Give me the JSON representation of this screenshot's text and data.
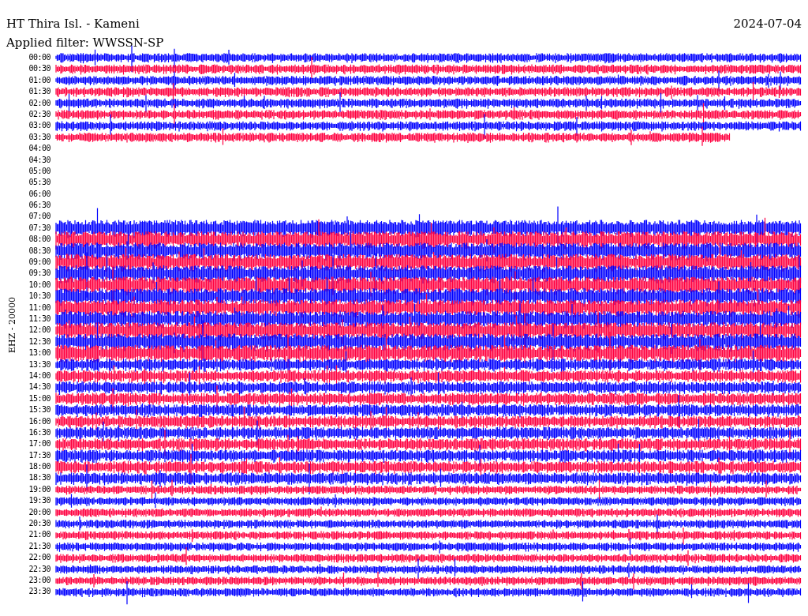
{
  "header": {
    "station": "HT Thira Isl. - Kameni",
    "date": "2024-07-04",
    "filter": "Applied filter: WWSSN-SP"
  },
  "channel_label": "EHZ - 20000",
  "rows": [
    {
      "time": "00:00",
      "kind": "trace",
      "color": "#0000ff"
    },
    {
      "time": "00:30",
      "kind": "trace",
      "color": "#ff0040"
    },
    {
      "time": "01:00",
      "kind": "trace",
      "color": "#0000ff"
    },
    {
      "time": "01:30",
      "kind": "trace",
      "color": "#ff0040"
    },
    {
      "time": "02:00",
      "kind": "trace",
      "color": "#0000ff"
    },
    {
      "time": "02:30",
      "kind": "trace",
      "color": "#ff0040"
    },
    {
      "time": "03:00",
      "kind": "trace",
      "color": "#0000ff"
    },
    {
      "time": "03:30",
      "kind": "partial",
      "color": "#ff0040"
    },
    {
      "time": "04:00",
      "kind": "empty"
    },
    {
      "time": "04:30",
      "kind": "empty"
    },
    {
      "time": "05:00",
      "kind": "empty"
    },
    {
      "time": "05:30",
      "kind": "empty"
    },
    {
      "time": "06:00",
      "kind": "empty"
    },
    {
      "time": "06:30",
      "kind": "empty"
    },
    {
      "time": "07:00",
      "kind": "empty"
    },
    {
      "time": "07:30",
      "kind": "trace",
      "color": "#0000ff"
    },
    {
      "time": "08:00",
      "kind": "trace",
      "color": "#ff0040"
    },
    {
      "time": "08:30",
      "kind": "trace",
      "color": "#0000ff"
    },
    {
      "time": "09:00",
      "kind": "trace",
      "color": "#ff0040"
    },
    {
      "time": "09:30",
      "kind": "trace",
      "color": "#0000ff"
    },
    {
      "time": "10:00",
      "kind": "trace",
      "color": "#ff0040"
    },
    {
      "time": "10:30",
      "kind": "trace",
      "color": "#0000ff"
    },
    {
      "time": "11:00",
      "kind": "trace",
      "color": "#ff0040"
    },
    {
      "time": "11:30",
      "kind": "trace",
      "color": "#0000ff"
    },
    {
      "time": "12:00",
      "kind": "trace",
      "color": "#ff0040"
    },
    {
      "time": "12:30",
      "kind": "trace",
      "color": "#0000ff"
    },
    {
      "time": "13:00",
      "kind": "trace",
      "color": "#ff0040"
    },
    {
      "time": "13:30",
      "kind": "trace",
      "color": "#0000ff"
    },
    {
      "time": "14:00",
      "kind": "trace",
      "color": "#ff0040"
    },
    {
      "time": "14:30",
      "kind": "trace",
      "color": "#0000ff"
    },
    {
      "time": "15:00",
      "kind": "trace",
      "color": "#ff0040"
    },
    {
      "time": "15:30",
      "kind": "trace",
      "color": "#0000ff"
    },
    {
      "time": "16:00",
      "kind": "trace",
      "color": "#ff0040"
    },
    {
      "time": "16:30",
      "kind": "trace",
      "color": "#0000ff"
    },
    {
      "time": "17:00",
      "kind": "trace",
      "color": "#ff0040"
    },
    {
      "time": "17:30",
      "kind": "trace",
      "color": "#0000ff"
    },
    {
      "time": "18:00",
      "kind": "trace",
      "color": "#ff0040"
    },
    {
      "time": "18:30",
      "kind": "trace",
      "color": "#0000ff"
    },
    {
      "time": "19:00",
      "kind": "trace",
      "color": "#ff0040"
    },
    {
      "time": "19:30",
      "kind": "trace",
      "color": "#0000ff"
    },
    {
      "time": "20:00",
      "kind": "trace",
      "color": "#ff0040"
    },
    {
      "time": "20:30",
      "kind": "trace",
      "color": "#0000ff"
    },
    {
      "time": "21:00",
      "kind": "trace",
      "color": "#ff0040"
    },
    {
      "time": "21:30",
      "kind": "trace",
      "color": "#0000ff"
    },
    {
      "time": "22:00",
      "kind": "trace",
      "color": "#ff0040"
    },
    {
      "time": "22:30",
      "kind": "trace",
      "color": "#0000ff"
    },
    {
      "time": "23:00",
      "kind": "trace",
      "color": "#ff0040"
    },
    {
      "time": "23:30",
      "kind": "trace",
      "color": "#0000ff"
    }
  ]
}
